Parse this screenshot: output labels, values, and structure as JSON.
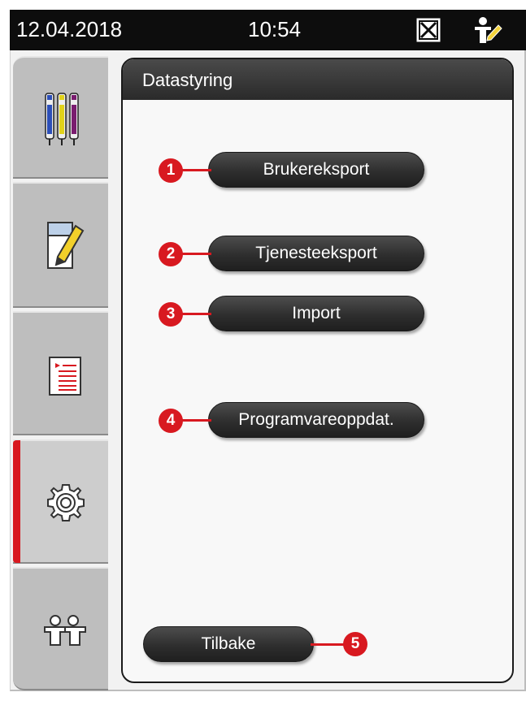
{
  "status_bar": {
    "date": "12.04.2018",
    "time": "10:54",
    "icons": [
      "no-connection-icon",
      "user-edit-icon"
    ]
  },
  "sidebar": {
    "items": [
      {
        "icon": "reagent-bottles-icon",
        "active": false
      },
      {
        "icon": "program-edit-icon",
        "active": false
      },
      {
        "icon": "program-list-icon",
        "active": false
      },
      {
        "icon": "settings-gear-icon",
        "active": true
      },
      {
        "icon": "user-access-icon",
        "active": false
      }
    ]
  },
  "panel": {
    "title": "Datastyring",
    "buttons": {
      "user_export": "Brukereksport",
      "service_export": "Tjenesteeksport",
      "import": "Import",
      "software_update": "Programvareoppdat.",
      "back": "Tilbake"
    }
  },
  "callouts": [
    "1",
    "2",
    "3",
    "4",
    "5"
  ],
  "colors": {
    "accent_red": "#d81920",
    "button_dark": "#2e2e2e",
    "header_dark": "#2a2a2a"
  }
}
